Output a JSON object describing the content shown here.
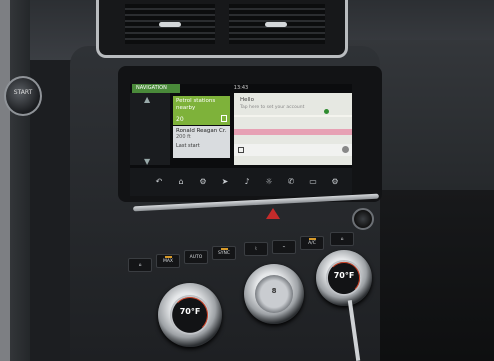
{
  "left_panel": {
    "start_label": "START"
  },
  "screen": {
    "status_time": "13:43",
    "tab": "NAVIGATION",
    "petrol_card": {
      "title": "Petrol stations nearby",
      "count": "20"
    },
    "recent_card": {
      "destination": "Ronald Reagan Cr...",
      "distance": "200 ft",
      "action": "Last start"
    },
    "map": {
      "greeting": "Hello",
      "subtitle": "Tap here to set your account"
    },
    "bottom_bar": [
      {
        "icon": "back-icon",
        "glyph": "↶"
      },
      {
        "icon": "home-icon",
        "glyph": "⌂"
      },
      {
        "icon": "connected-icon",
        "glyph": "⚙"
      },
      {
        "icon": "navigation-icon",
        "glyph": "➤"
      },
      {
        "icon": "audio-icon",
        "glyph": "♪"
      },
      {
        "icon": "climate-icon",
        "glyph": "☼"
      },
      {
        "icon": "phone-icon",
        "glyph": "✆"
      },
      {
        "icon": "media-icon",
        "glyph": "▭"
      },
      {
        "icon": "settings-icon",
        "glyph": "⚙"
      }
    ]
  },
  "climate_buttons": [
    {
      "label": "⌂",
      "icon": "seat-heat-left-icon"
    },
    {
      "label": "MAX",
      "icon": "max-defrost-icon",
      "led": true
    },
    {
      "label": "AUTO",
      "icon": "auto-icon"
    },
    {
      "label": "SYNC",
      "icon": "sync-icon",
      "led": true
    },
    {
      "label": "⌇",
      "icon": "seat-icon"
    },
    {
      "label": "⌁",
      "icon": "airflow-icon"
    },
    {
      "label": "A/C",
      "icon": "ac-icon",
      "led": true
    },
    {
      "label": "⌂",
      "icon": "seat-heat-right-icon"
    }
  ],
  "knobs": {
    "left": {
      "temp": "70°F"
    },
    "center": {
      "label": "8"
    },
    "right": {
      "temp": "70°F"
    }
  }
}
